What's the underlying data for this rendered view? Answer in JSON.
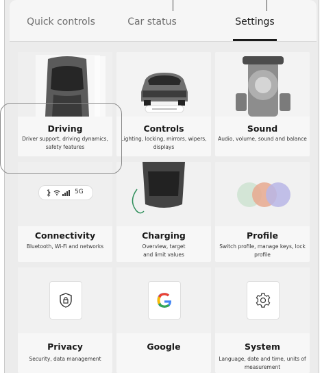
{
  "tabs": [
    {
      "label": "Quick controls"
    },
    {
      "label": "Car status"
    },
    {
      "label": "Settings"
    }
  ],
  "active_tab": "Settings",
  "cards": [
    {
      "title": "Driving",
      "desc": "Driver support, driving dynamics, safety features"
    },
    {
      "title": "Controls",
      "desc": "Lighting, locking, mirrors, wipers, displays"
    },
    {
      "title": "Sound",
      "desc": "Audio, volume, sound and balance"
    },
    {
      "title": "Connectivity",
      "desc": "Bluetooth, Wi-Fi and networks",
      "status_label": "5G"
    },
    {
      "title": "Charging",
      "desc": "Overview, target and limit values"
    },
    {
      "title": "Profile",
      "desc": "Switch profile, manage keys, lock profile"
    },
    {
      "title": "Privacy",
      "desc": "Security, data management",
      "icon": "shield-lock-icon"
    },
    {
      "title": "Google",
      "desc": "",
      "icon": "google-g-icon"
    },
    {
      "title": "System",
      "desc": "Language, date and time, units of measurement",
      "icon": "gear-icon"
    }
  ],
  "colors": {
    "panel": "#ececec",
    "card": "#f7f7f7",
    "text": "#1a1a1a",
    "google_blue": "#4285f4",
    "google_red": "#ea4335",
    "google_yellow": "#fbbc05",
    "google_green": "#34a853"
  }
}
